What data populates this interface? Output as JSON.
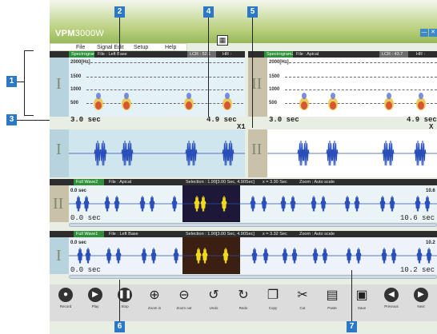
{
  "app": {
    "title_bold": "VPM",
    "title_rest": "3000W"
  },
  "window_buttons": [
    "—",
    "✕"
  ],
  "menu": [
    "File",
    "Signal Edit",
    "Setup",
    "Help"
  ],
  "spectrogram_left": {
    "header": {
      "tab": "Spectrogram",
      "file": "File : Left Base",
      "lcr": "LCR : 52.1",
      "hr": "HR :"
    },
    "roman": "I",
    "freq_labels": [
      "2000[Hz]",
      "1500",
      "1000",
      "500"
    ],
    "time_start": "3.0 sec",
    "time_end": "4.9 sec"
  },
  "spectrogram_right": {
    "header": {
      "tab": "Spectrogram2",
      "file": "File : Apical",
      "lcr": "LCR : 43.7",
      "hr": "HR :"
    },
    "roman": "II",
    "freq_labels": [
      "2000[Hz]",
      "1500",
      "1000",
      "500"
    ],
    "time_start": "3.0 sec",
    "time_end": "4.9 sec",
    "zoom_mark": "X"
  },
  "zoom_left": "X1",
  "wave_left_roman": "I",
  "wave_right_roman": "II",
  "full_wave2": {
    "tab": "Full Wave2",
    "file": "File : Apical",
    "selection": "Selection : 1.90[3.00 Sec, 4.90Sec]",
    "x": "x = 3.30 Sec",
    "zoom": "Zoom : Auto scale",
    "roman": "II",
    "top_left": "0.0 sec",
    "top_right": "10.6",
    "bottom_left": "0.0 sec",
    "bottom_right": "10.6 sec"
  },
  "full_wave1": {
    "tab": "Full Wave1",
    "file": "File : Left Base",
    "selection": "Selection : 1.90[3.00 Sec, 4.90Sec]",
    "x": "x = 3.32 Sec",
    "zoom": "Zoom : Auto scale",
    "roman": "I",
    "top_left": "0.0 sec",
    "top_right": "10.2",
    "bottom_left": "0.0 sec",
    "bottom_right": "10.2 sec"
  },
  "toolbar": [
    {
      "label": "Record",
      "icon": "record-icon"
    },
    {
      "label": "Play",
      "icon": "play-icon"
    },
    {
      "label": "Stop",
      "icon": "pause-icon"
    },
    {
      "label": "Zoom in",
      "icon": "zoom-in-icon"
    },
    {
      "label": "Zoom out",
      "icon": "zoom-out-icon"
    },
    {
      "label": "Undo",
      "icon": "undo-icon"
    },
    {
      "label": "Redo",
      "icon": "redo-icon"
    },
    {
      "label": "Copy",
      "icon": "copy-icon"
    },
    {
      "label": "Cut",
      "icon": "cut-icon"
    },
    {
      "label": "Paste",
      "icon": "paste-icon"
    },
    {
      "label": "Save",
      "icon": "save-icon"
    },
    {
      "label": "Previous",
      "icon": "previous-icon"
    },
    {
      "label": "Next",
      "icon": "next-icon"
    }
  ],
  "callouts": [
    "1",
    "2",
    "3",
    "4",
    "5",
    "6",
    "7"
  ],
  "colors": {
    "callout": "#2b78c9",
    "title_green": "#97b85a",
    "wave": "#2a4fb8",
    "selection_wave": "#f2d91c"
  }
}
